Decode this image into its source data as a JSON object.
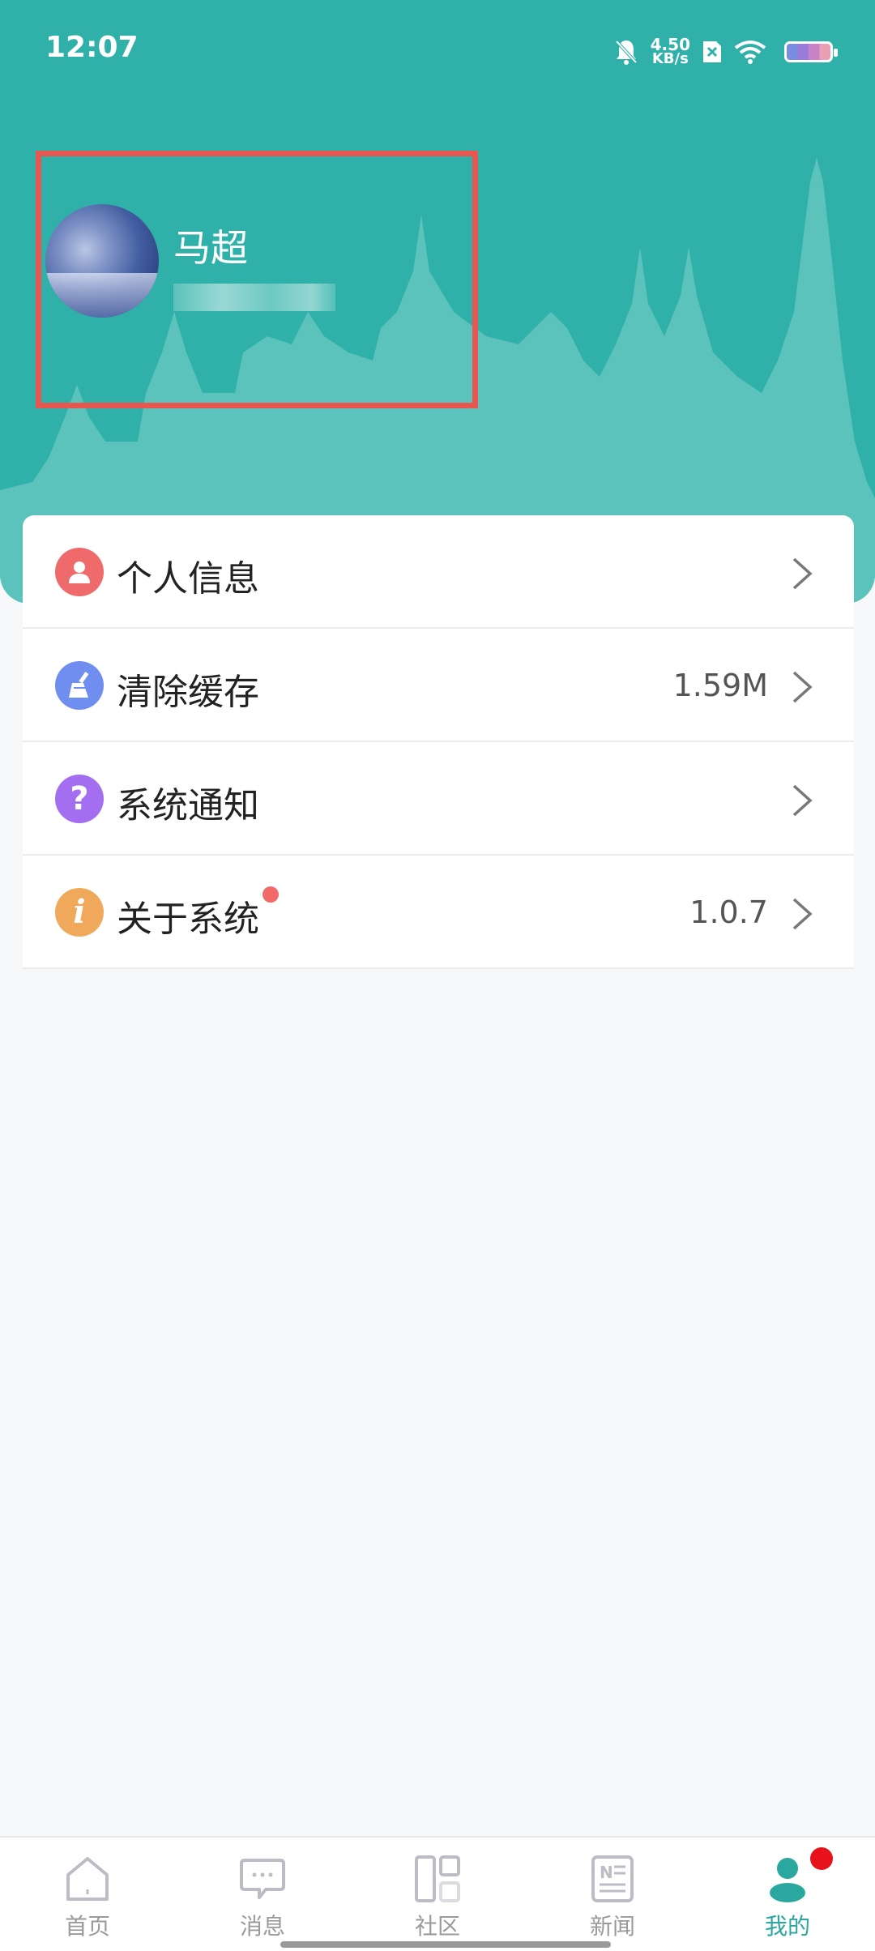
{
  "status_bar": {
    "time": "12:07",
    "net_speed_value": "4.50",
    "net_speed_unit": "KB/s",
    "icons": [
      "bell-muted-icon",
      "sim-x-icon",
      "wifi-icon",
      "battery-icon"
    ]
  },
  "profile": {
    "name": "马超"
  },
  "menu": {
    "items": [
      {
        "label": "个人信息",
        "value": "",
        "icon": "person-icon",
        "color": "#ef6b6b"
      },
      {
        "label": "清除缓存",
        "value": "1.59M",
        "icon": "broom-icon",
        "color": "#6f8ef0"
      },
      {
        "label": "系统通知",
        "value": "",
        "icon": "question-icon",
        "color": "#a36ff0"
      },
      {
        "label": "关于系统",
        "value": "1.0.7",
        "icon": "info-icon",
        "color": "#f0a95b"
      }
    ]
  },
  "tabbar": {
    "tabs": [
      {
        "label": "首页",
        "icon": "home-icon"
      },
      {
        "label": "消息",
        "icon": "message-icon"
      },
      {
        "label": "社区",
        "icon": "grid-icon"
      },
      {
        "label": "新闻",
        "icon": "news-icon"
      },
      {
        "label": "我的",
        "icon": "user-icon"
      }
    ],
    "active_color": "#2aa79f"
  },
  "theme": {
    "accent": "#2fb1a9",
    "highlight_border": "#e8574f",
    "badge": "#e8121c"
  }
}
